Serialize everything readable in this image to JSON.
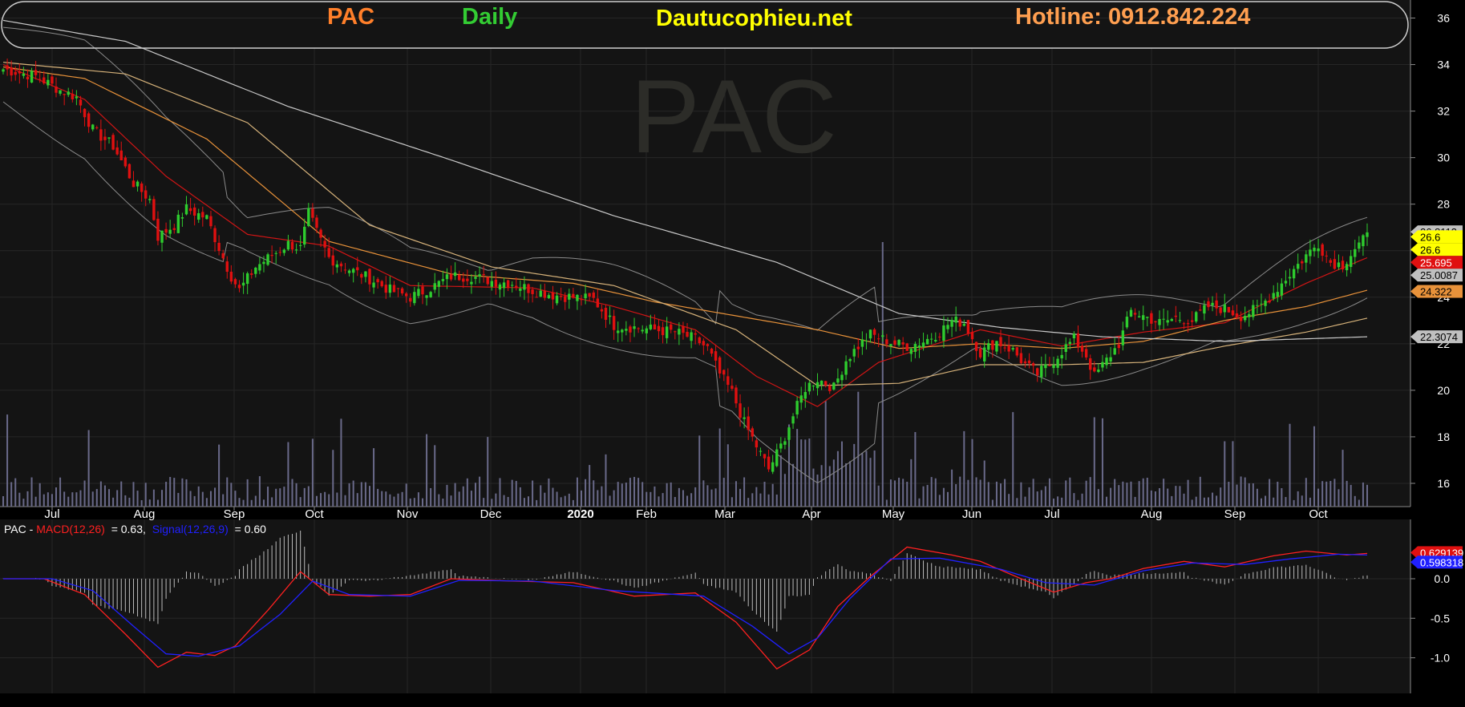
{
  "header": {
    "symbol": "PAC",
    "period": "Daily",
    "site": "Dautucophieu.net",
    "hotline": "Hotline: 0912.842.224"
  },
  "watermark": "PAC",
  "macd_legend": {
    "symbol": "PAC",
    "macd_label": "MACD(12,26)",
    "macd_value": "= 0.63,",
    "signal_label": "Signal(12,26,9)",
    "signal_value": "= 0.60"
  },
  "colors": {
    "background": "#000000",
    "panel": "#141414",
    "up": "#2ecc2e",
    "down": "#e01010",
    "ma_red": "#d01515",
    "ma_orange": "#e8923a",
    "ma_tan": "#d6b27a",
    "ma_white": "#c8c8c8",
    "bollinger": "#8a8a8a",
    "volume": "#6a6a8a",
    "macd": "#ff2020",
    "signal": "#2020ff",
    "header_symbol": "#ff7f2a",
    "header_period": "#33cc33",
    "header_site": "#ffff00",
    "header_hotline": "#ff9f50"
  },
  "chart_data": [
    {
      "type": "candlestick",
      "ylim": [
        15,
        36.5
      ],
      "y_ticks": [
        16,
        18,
        20,
        22,
        24,
        26,
        28,
        30,
        32,
        34,
        36
      ],
      "x_ticks": [
        "Jul",
        "Aug",
        "Sep",
        "Oct",
        "Nov",
        "Dec",
        "2020",
        "Feb",
        "Mar",
        "Apr",
        "May",
        "Jun",
        "Jul",
        "Aug",
        "Sep",
        "Oct"
      ],
      "price_path": [
        [
          0,
          33.8
        ],
        [
          8,
          33.5
        ],
        [
          14,
          32.9
        ],
        [
          18,
          32.6
        ],
        [
          22,
          31.2
        ],
        [
          27,
          30.5
        ],
        [
          32,
          28.9
        ],
        [
          36,
          28.2
        ],
        [
          38,
          26.6
        ],
        [
          42,
          27.1
        ],
        [
          45,
          27.8
        ],
        [
          50,
          27.4
        ],
        [
          54,
          25.7
        ],
        [
          56,
          24.9
        ],
        [
          58,
          24.3
        ],
        [
          62,
          25.3
        ],
        [
          66,
          25.8
        ],
        [
          70,
          26.3
        ],
        [
          73,
          26.1
        ],
        [
          75,
          27.6
        ],
        [
          77,
          26.8
        ],
        [
          80,
          25.7
        ],
        [
          85,
          25.2
        ],
        [
          90,
          24.8
        ],
        [
          95,
          24.3
        ],
        [
          100,
          24.0
        ],
        [
          105,
          24.4
        ],
        [
          110,
          24.9
        ],
        [
          115,
          24.9
        ],
        [
          120,
          24.7
        ],
        [
          125,
          24.6
        ],
        [
          130,
          24.3
        ],
        [
          135,
          24.1
        ],
        [
          140,
          24.0
        ],
        [
          145,
          23.9
        ],
        [
          150,
          22.8
        ],
        [
          155,
          22.7
        ],
        [
          160,
          22.6
        ],
        [
          165,
          22.5
        ],
        [
          170,
          22.2
        ],
        [
          173,
          21.8
        ],
        [
          176,
          20.7
        ],
        [
          179,
          19.9
        ],
        [
          182,
          18.6
        ],
        [
          185,
          17.6
        ],
        [
          188,
          16.6
        ],
        [
          191,
          17.6
        ],
        [
          194,
          18.9
        ],
        [
          197,
          20.1
        ],
        [
          200,
          20.5
        ],
        [
          204,
          20.1
        ],
        [
          207,
          21.3
        ],
        [
          210,
          21.9
        ],
        [
          213,
          22.4
        ],
        [
          216,
          22.2
        ],
        [
          219,
          22.0
        ],
        [
          222,
          21.9
        ],
        [
          226,
          22.1
        ],
        [
          230,
          22.5
        ],
        [
          233,
          23.0
        ],
        [
          236,
          22.9
        ],
        [
          240,
          21.6
        ],
        [
          244,
          22.1
        ],
        [
          248,
          21.7
        ],
        [
          251,
          21.1
        ],
        [
          254,
          20.7
        ],
        [
          257,
          21.1
        ],
        [
          260,
          21.7
        ],
        [
          263,
          22.2
        ],
        [
          266,
          21.5
        ],
        [
          268,
          20.6
        ],
        [
          271,
          21.3
        ],
        [
          274,
          22.0
        ],
        [
          277,
          23.4
        ],
        [
          280,
          23.2
        ],
        [
          284,
          22.9
        ],
        [
          288,
          23.1
        ],
        [
          292,
          23.0
        ],
        [
          296,
          23.6
        ],
        [
          300,
          23.5
        ],
        [
          304,
          23.2
        ],
        [
          308,
          23.5
        ],
        [
          311,
          24.0
        ],
        [
          314,
          24.6
        ],
        [
          317,
          25.2
        ],
        [
          320,
          25.8
        ],
        [
          323,
          26.3
        ],
        [
          326,
          25.5
        ],
        [
          329,
          25.4
        ],
        [
          332,
          26.1
        ],
        [
          335,
          26.6
        ]
      ],
      "moving_averages": [
        {
          "values": [
            [
              0,
              34.0
            ],
            [
              20,
              32.5
            ],
            [
              40,
              29.2
            ],
            [
              60,
              26.7
            ],
            [
              80,
              26.2
            ],
            [
              100,
              24.5
            ],
            [
              130,
              24.4
            ],
            [
              150,
              23.6
            ],
            [
              170,
              22.6
            ],
            [
              185,
              20.6
            ],
            [
              200,
              19.3
            ],
            [
              215,
              21.2
            ],
            [
              240,
              22.6
            ],
            [
              260,
              21.9
            ],
            [
              280,
              22.5
            ],
            [
              300,
              22.9
            ],
            [
              320,
              24.6
            ],
            [
              335,
              25.7
            ]
          ],
          "color": "#d01515"
        },
        {
          "values": [
            [
              0,
              33.9
            ],
            [
              20,
              33.4
            ],
            [
              50,
              30.8
            ],
            [
              80,
              26.4
            ],
            [
              110,
              25.0
            ],
            [
              140,
              24.6
            ],
            [
              160,
              23.8
            ],
            [
              180,
              23.2
            ],
            [
              200,
              22.6
            ],
            [
              220,
              21.8
            ],
            [
              240,
              22.0
            ],
            [
              260,
              21.8
            ],
            [
              280,
              22.1
            ],
            [
              300,
              23.0
            ],
            [
              320,
              23.6
            ],
            [
              335,
              24.3
            ]
          ],
          "color": "#e8923a"
        },
        {
          "values": [
            [
              0,
              34.1
            ],
            [
              30,
              33.6
            ],
            [
              60,
              31.5
            ],
            [
              90,
              27.1
            ],
            [
              120,
              25.3
            ],
            [
              150,
              24.5
            ],
            [
              180,
              22.6
            ],
            [
              200,
              20.2
            ],
            [
              220,
              20.3
            ],
            [
              240,
              21.1
            ],
            [
              260,
              21.1
            ],
            [
              280,
              21.2
            ],
            [
              300,
              21.9
            ],
            [
              320,
              22.5
            ],
            [
              335,
              23.1
            ]
          ],
          "color": "#d6b27a"
        },
        {
          "values": [
            [
              0,
              35.9
            ],
            [
              30,
              35.0
            ],
            [
              70,
              32.2
            ],
            [
              110,
              29.9
            ],
            [
              150,
              27.5
            ],
            [
              190,
              25.5
            ],
            [
              220,
              23.3
            ],
            [
              245,
              22.7
            ],
            [
              270,
              22.3
            ],
            [
              300,
              22.1
            ],
            [
              335,
              22.3
            ]
          ],
          "color": "#c8c8c8"
        }
      ],
      "last_values": [
        {
          "label": "26.8113",
          "value": 26.8113,
          "bg": "#c0c0c0",
          "fg": "#000000"
        },
        {
          "label": "26.6",
          "value": 26.6,
          "bg": "#ffff00",
          "fg": "#000000"
        },
        {
          "label": "26.6",
          "value": 26.05,
          "bg": "#ffff00",
          "fg": "#000000"
        },
        {
          "label": "25.695",
          "value": 25.5,
          "bg": "#e01010",
          "fg": "#ffffff"
        },
        {
          "label": "25.0087",
          "value": 24.95,
          "bg": "#c0c0c0",
          "fg": "#000000"
        },
        {
          "label": "24.322",
          "value": 24.25,
          "bg": "#e8923a",
          "fg": "#000000"
        },
        {
          "label": "22.3074",
          "value": 22.3,
          "bg": "#c0c0c0",
          "fg": "#000000"
        }
      ]
    },
    {
      "type": "line",
      "ylim": [
        -1.45,
        0.75
      ],
      "y_ticks": [
        -1.0,
        -0.5,
        0.0
      ],
      "y_tick_labels": [
        "-1.0",
        "-0.5",
        "0.0"
      ],
      "series": [
        {
          "name": "MACD(12,26)",
          "color": "#ff2020",
          "values": [
            [
              0,
              0.0
            ],
            [
              10,
              0.0
            ],
            [
              20,
              -0.2
            ],
            [
              30,
              -0.7
            ],
            [
              38,
              -1.12
            ],
            [
              45,
              -0.93
            ],
            [
              52,
              -0.97
            ],
            [
              57,
              -0.85
            ],
            [
              65,
              -0.4
            ],
            [
              73,
              0.09
            ],
            [
              80,
              -0.2
            ],
            [
              90,
              -0.22
            ],
            [
              100,
              -0.2
            ],
            [
              110,
              0.0
            ],
            [
              125,
              -0.03
            ],
            [
              140,
              -0.05
            ],
            [
              155,
              -0.22
            ],
            [
              170,
              -0.18
            ],
            [
              180,
              -0.55
            ],
            [
              190,
              -1.14
            ],
            [
              198,
              -0.9
            ],
            [
              205,
              -0.35
            ],
            [
              213,
              0.03
            ],
            [
              222,
              0.4
            ],
            [
              233,
              0.3
            ],
            [
              240,
              0.22
            ],
            [
              250,
              0.0
            ],
            [
              258,
              -0.17
            ],
            [
              266,
              -0.05
            ],
            [
              272,
              0.0
            ],
            [
              280,
              0.13
            ],
            [
              290,
              0.22
            ],
            [
              300,
              0.15
            ],
            [
              312,
              0.29
            ],
            [
              320,
              0.35
            ],
            [
              330,
              0.3
            ],
            [
              335,
              0.32
            ]
          ]
        },
        {
          "name": "Signal(12,26,9)",
          "color": "#2020ff",
          "values": [
            [
              0,
              0.0
            ],
            [
              12,
              0.0
            ],
            [
              22,
              -0.15
            ],
            [
              32,
              -0.6
            ],
            [
              40,
              -0.95
            ],
            [
              48,
              -0.98
            ],
            [
              58,
              -0.85
            ],
            [
              68,
              -0.45
            ],
            [
              76,
              -0.03
            ],
            [
              85,
              -0.2
            ],
            [
              100,
              -0.22
            ],
            [
              112,
              -0.02
            ],
            [
              130,
              -0.03
            ],
            [
              150,
              -0.15
            ],
            [
              172,
              -0.22
            ],
            [
              184,
              -0.6
            ],
            [
              193,
              -0.95
            ],
            [
              200,
              -0.75
            ],
            [
              208,
              -0.25
            ],
            [
              218,
              0.25
            ],
            [
              230,
              0.26
            ],
            [
              245,
              0.12
            ],
            [
              256,
              -0.05
            ],
            [
              268,
              -0.08
            ],
            [
              280,
              0.1
            ],
            [
              292,
              0.2
            ],
            [
              305,
              0.18
            ],
            [
              316,
              0.25
            ],
            [
              328,
              0.31
            ],
            [
              335,
              0.3
            ]
          ]
        }
      ],
      "last_values": [
        {
          "label": "0.629139",
          "value": 0.33,
          "bg": "#e01010",
          "fg": "#ffffff"
        },
        {
          "label": "0.598318",
          "value": 0.21,
          "bg": "#2020ff",
          "fg": "#ffffff"
        }
      ]
    }
  ]
}
